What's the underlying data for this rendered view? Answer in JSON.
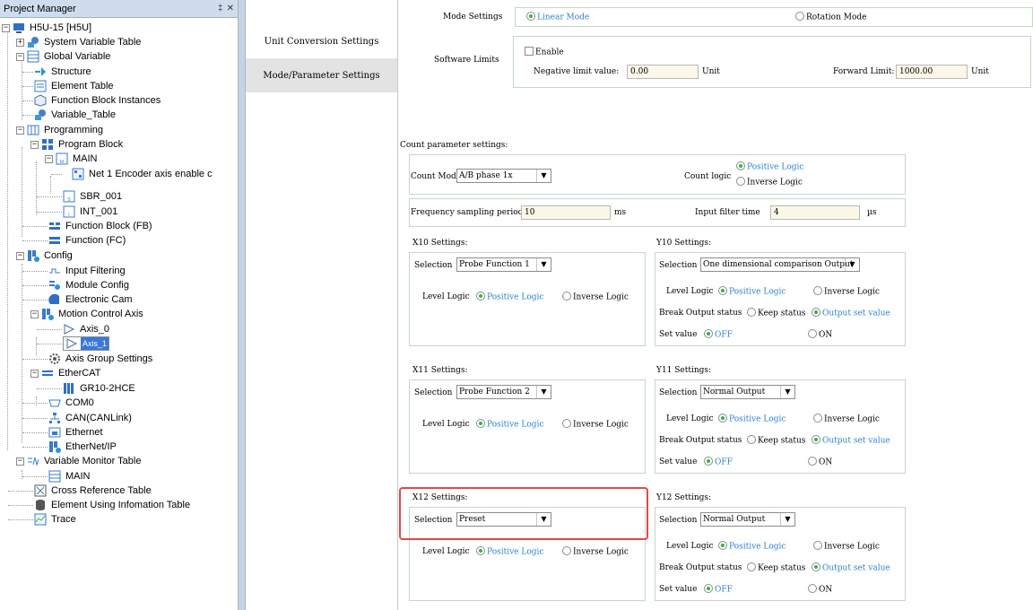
{
  "project_manager": {
    "title": "Project Manager",
    "pin": "‡",
    "close": "✕",
    "tree": {
      "root": "H5U-15 [H5U]",
      "system_variable_table": "System Variable Table",
      "global_variable": "Global Variable",
      "structure": "Structure",
      "element_table": "Element Table",
      "function_block_instances": "Function Block Instances",
      "variable_table": "Variable_Table",
      "programming": "Programming",
      "program_block": "Program Block",
      "main": "MAIN",
      "net1": "Net 1 Encoder axis enable c",
      "sbr": "SBR_001",
      "int": "INT_001",
      "function_block": "Function Block (FB)",
      "function": "Function (FC)",
      "config": "Config",
      "input_filtering": "Input Filtering",
      "module_config": "Module Config",
      "electronic_cam": "Electronic Cam",
      "motion_control_axis": "Motion Control Axis",
      "axis0": "Axis_0",
      "axis1": "Axis_1",
      "axis_group": "Axis Group Settings",
      "ethercat": "EtherCAT",
      "gr10": "GR10-2HCE",
      "com0": "COM0",
      "can": "CAN(CANLink)",
      "ethernet": "Ethernet",
      "ethernetip": "EtherNet/IP",
      "variable_monitor_table": "Variable Monitor Table",
      "monitor_main": "MAIN",
      "cross_reference": "Cross Reference Table",
      "element_using": "Element Using Infomation Table",
      "trace": "Trace"
    }
  },
  "nav": {
    "unit_conversion": "Unit Conversion Settings",
    "mode_parameter": "Mode/Parameter Settings"
  },
  "mode": {
    "label": "Mode Settings",
    "linear": "Linear Mode",
    "rotation": "Rotation Mode"
  },
  "soft_limits": {
    "label": "Software Limits",
    "enable": "Enable",
    "neg_label": "Negative limit value:",
    "neg_value": "0.00",
    "neg_unit": "Unit",
    "fwd_label": "Forward Limit:",
    "fwd_value": "1000.00",
    "fwd_unit": "Unit"
  },
  "count": {
    "heading": "Count parameter settings:",
    "mode_label": "Count Mode",
    "mode_value": "A/B phase 1x",
    "logic_label": "Count logic",
    "positive": "Positive Logic",
    "inverse": "Inverse Logic",
    "freq_label": "Frequency sampling period",
    "freq_value": "10",
    "freq_unit": "ms",
    "filter_label": "Input filter time",
    "filter_value": "4",
    "filter_unit": "µs"
  },
  "common": {
    "selection": "Selection",
    "level_logic": "Level Logic",
    "positive": "Positive Logic",
    "inverse": "Inverse Logic",
    "break_output": "Break Output status",
    "keep_status": "Keep status",
    "output_set": "Output set value",
    "set_value": "Set value",
    "off": "OFF",
    "on": "ON"
  },
  "x10": {
    "heading": "X10 Settings:",
    "selection": "Probe Function 1"
  },
  "y10": {
    "heading": "Y10 Settings:",
    "selection": "One dimensional comparison Output"
  },
  "x11": {
    "heading": "X11 Settings:",
    "selection": "Probe Function 2"
  },
  "y11": {
    "heading": "Y11 Settings:",
    "selection": "Normal Output"
  },
  "x12": {
    "heading": "X12 Settings:",
    "selection": "Preset"
  },
  "y12": {
    "heading": "Y12 Settings:",
    "selection": "Normal Output"
  },
  "colors": {
    "highlight": "#e0484c",
    "radio_on": "#2fb446",
    "option_text": "#2d7fd0"
  }
}
